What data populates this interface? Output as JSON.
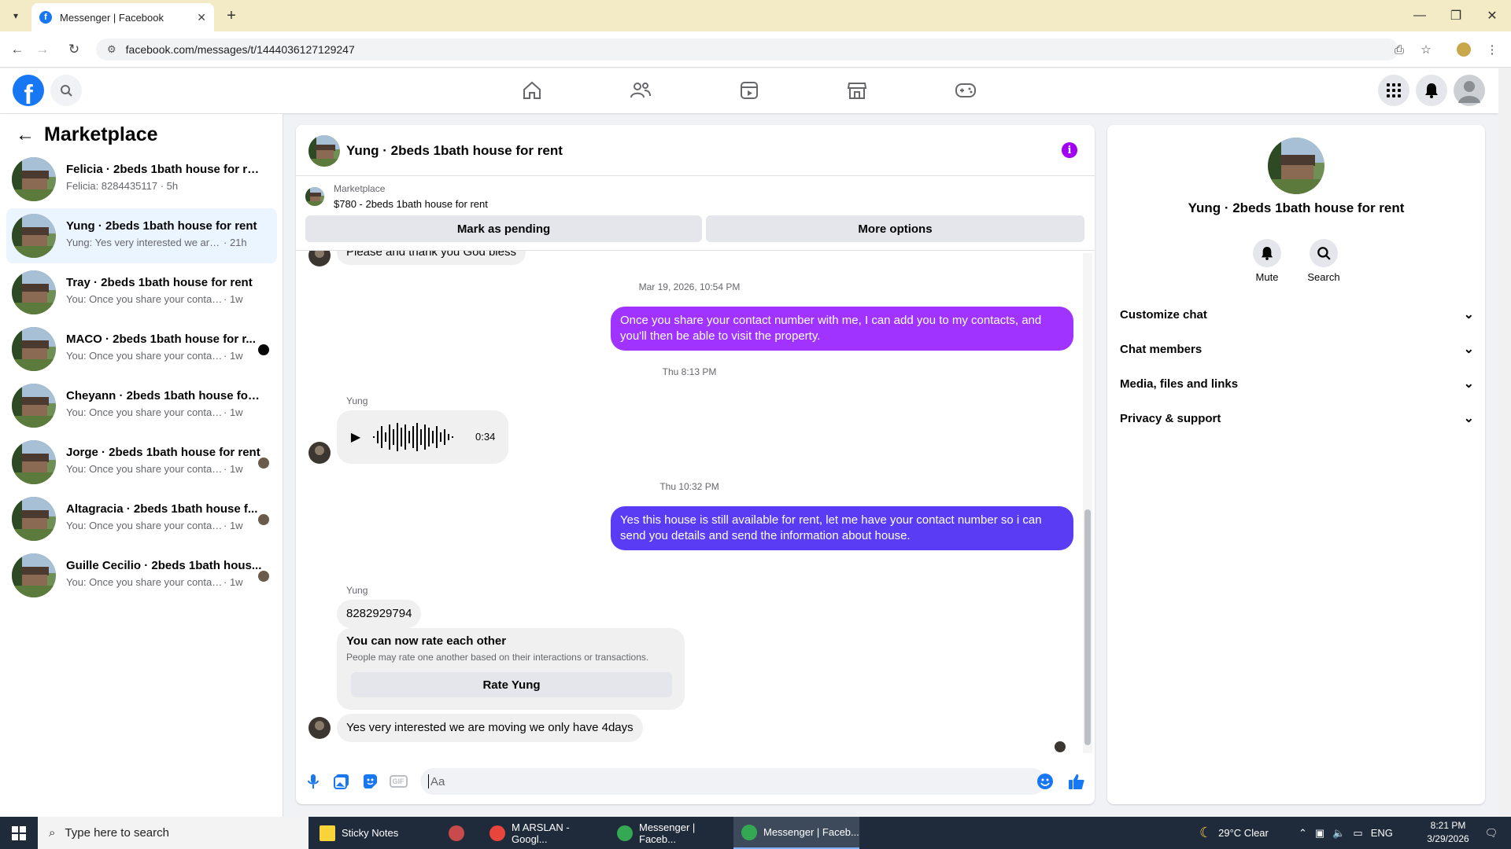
{
  "browser": {
    "tab_title": "Messenger | Facebook",
    "url": "facebook.com/messages/t/1444036127129247"
  },
  "sidebar": {
    "title": "Marketplace",
    "conversations": [
      {
        "title": "Felicia · 2beds 1bath house for rent",
        "snippet": "Felicia: 8284435117 · 5h",
        "time": "",
        "active": false,
        "indicator": ""
      },
      {
        "title": "Yung · 2beds 1bath house for rent",
        "snippet": "Yung: Yes very interested we are mo...",
        "time": "· 21h",
        "active": true,
        "indicator": ""
      },
      {
        "title": "Tray · 2beds 1bath house for rent",
        "snippet": "You: Once you share your contact nu...",
        "time": "· 1w",
        "active": false,
        "indicator": ""
      },
      {
        "title": "MACO · 2beds 1bath house for r...",
        "snippet": "You: Once you share your contact ...",
        "time": "· 1w",
        "active": false,
        "indicator": "unread"
      },
      {
        "title": "Cheyann · 2beds 1bath house for r...",
        "snippet": "You: Once you share your contact nu...",
        "time": "· 1w",
        "active": false,
        "indicator": ""
      },
      {
        "title": "Jorge · 2beds 1bath house for rent",
        "snippet": "You: Once you share your contact ...",
        "time": "· 1w",
        "active": false,
        "indicator": "seen"
      },
      {
        "title": "Altagracia · 2beds 1bath house f...",
        "snippet": "You: Once you share your contact ...",
        "time": "· 1w",
        "active": false,
        "indicator": "seen"
      },
      {
        "title": "Guille Cecilio · 2beds 1bath hous...",
        "snippet": "You: Once you share your contact ...",
        "time": "· 1w",
        "active": false,
        "indicator": "seen"
      }
    ]
  },
  "chat": {
    "title": "Yung · 2beds 1bath house for rent",
    "marketplace_label": "Marketplace",
    "listing": "$780 - 2beds 1bath house for rent",
    "mark_pending": "Mark as pending",
    "more_options": "More options",
    "partial_message": "Please and thank you God bless",
    "ts1": "Mar 19, 2026, 10:54 PM",
    "msg_out_1": "Once you share your contact number with me, I can add you to my contacts, and you'll then be able to visit the property.",
    "ts2": "Thu 8:13 PM",
    "sender_1": "Yung",
    "voice_duration": "0:34",
    "ts3": "Thu 10:32 PM",
    "msg_out_2": "Yes this house is still available for rent, let me have your contact number so i can send you details and send the information about house.",
    "sender_2": "Yung",
    "msg_in_phone": "8282929794",
    "rate_title": "You can now rate each other",
    "rate_desc": "People may rate one another based on their interactions or transactions.",
    "rate_button": "Rate Yung",
    "msg_in_last": "Yes very interested we are moving we only have 4days",
    "composer_placeholder": "Aa",
    "colors": {
      "bubble_out_1": "#a033ff",
      "bubble_out_2": "#5b3cf5",
      "accent": "#1877f2"
    }
  },
  "info": {
    "name": "Yung · 2beds 1bath house for rent",
    "mute": "Mute",
    "search": "Search",
    "rows": [
      "Customize chat",
      "Chat members",
      "Media, files and links",
      "Privacy & support"
    ]
  },
  "taskbar": {
    "search_placeholder": "Type here to search",
    "apps": [
      "Sticky Notes",
      "M ARSLAN - Googl...",
      "Messenger | Faceb...",
      "Messenger | Faceb..."
    ],
    "weather": "29°C  Clear",
    "lang": "ENG",
    "time": "8:21 PM",
    "date": "3/29/2026"
  }
}
